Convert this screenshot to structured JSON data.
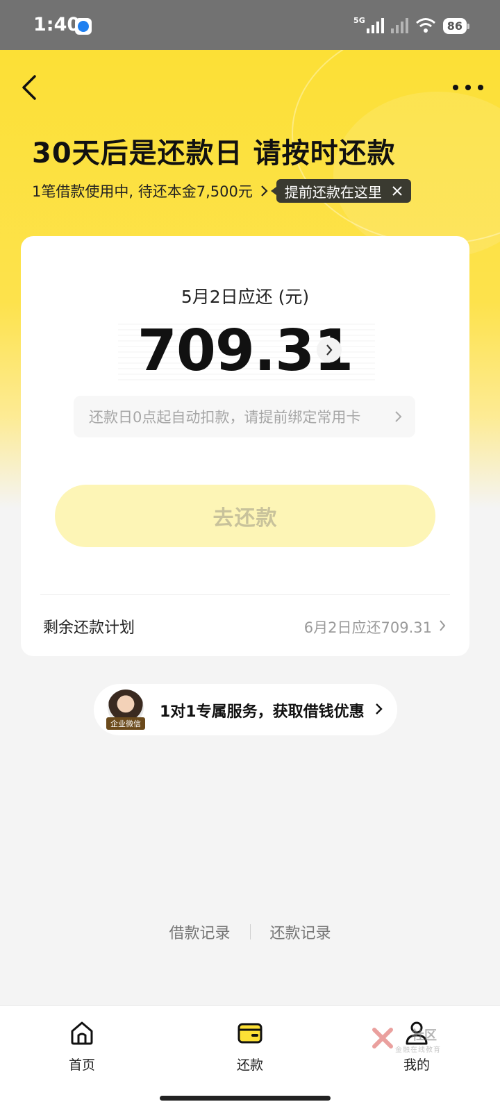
{
  "status_bar": {
    "time": "1:40",
    "network": "5G",
    "battery": "86"
  },
  "header": {
    "title": "30天后是还款日 请按时还款",
    "subtitle": "1笔借款使用中, 待还本金7,500元",
    "tooltip": "提前还款在这里"
  },
  "card": {
    "due_label": "5月2日应还 (元)",
    "amount": "709.31",
    "notice": "还款日0点起自动扣款，请提前绑定常用卡",
    "pay_button": "去还款",
    "plan_label": "剩余还款计划",
    "plan_value": "6月2日应还709.31"
  },
  "service": {
    "avatar_tag": "企业微信",
    "text": "1对1专属服务，获取借钱优惠"
  },
  "records": {
    "loan_records": "借款记录",
    "repay_records": "还款记录"
  },
  "bottom_nav": {
    "items": [
      {
        "label": "首页",
        "icon": "home-icon"
      },
      {
        "label": "还款",
        "icon": "wallet-icon"
      },
      {
        "label": "我的",
        "icon": "person-icon"
      }
    ]
  },
  "watermark": {
    "text": "社区",
    "sub": "金融在线教育"
  },
  "colors": {
    "brand_yellow": "#fce036",
    "button_disabled": "#fdf5b6",
    "tooltip_bg": "#3a3a30"
  }
}
